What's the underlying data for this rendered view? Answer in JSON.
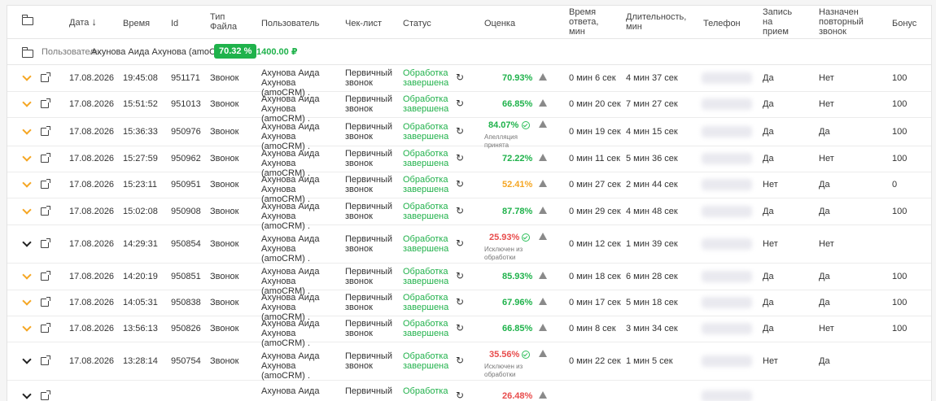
{
  "header": {
    "date": "Дата",
    "time": "Время",
    "id": "Id",
    "file_type": "Тип Файла",
    "user": "Пользователь",
    "checklist": "Чек-лист",
    "status": "Статус",
    "score": "Оценка",
    "response_time": "Время ответа, мин",
    "duration": "Длительность, мин",
    "phone": "Телефон",
    "appointment": "Запись на прием",
    "repeat_call": "Назначен повторный звонок",
    "bonus": "Бонус"
  },
  "group": {
    "label": "Пользователь:",
    "name": "Ахунова Аида Ахунова (amoCRM) .",
    "percent": "70.32 %",
    "amount": "1400.00 ₽"
  },
  "rows": [
    {
      "date": "17.08.2026",
      "time": "19:45:08",
      "id": "951171",
      "type": "Звонок",
      "user": "Ахунова Аида Ахунова (amoCRM) .",
      "checklist": "Первичный звонок",
      "status": "Обработка завершена",
      "score": "70.93%",
      "score_color": "green",
      "note": "",
      "response": "0 мин 6 сек",
      "duration": "4 мин 37 сек",
      "appointment": "Да",
      "repeat": "Нет",
      "bonus": "100",
      "expanded": false
    },
    {
      "date": "17.08.2026",
      "time": "15:51:52",
      "id": "951013",
      "type": "Звонок",
      "user": "Ахунова Аида Ахунова (amoCRM) .",
      "checklist": "Первичный звонок",
      "status": "Обработка завершена",
      "score": "66.85%",
      "score_color": "green",
      "note": "",
      "response": "0 мин 20 сек",
      "duration": "7 мин 27 сек",
      "appointment": "Да",
      "repeat": "Нет",
      "bonus": "100",
      "expanded": false
    },
    {
      "date": "17.08.2026",
      "time": "15:36:33",
      "id": "950976",
      "type": "Звонок",
      "user": "Ахунова Аида Ахунова (amoCRM) .",
      "checklist": "Первичный звонок",
      "status": "Обработка завершена",
      "score": "84.07%",
      "score_color": "green",
      "note": "Апелляция принята",
      "response": "0 мин 19 сек",
      "duration": "4 мин 15 сек",
      "appointment": "Да",
      "repeat": "Да",
      "bonus": "100",
      "expanded": false
    },
    {
      "date": "17.08.2026",
      "time": "15:27:59",
      "id": "950962",
      "type": "Звонок",
      "user": "Ахунова Аида Ахунова (amoCRM) .",
      "checklist": "Первичный звонок",
      "status": "Обработка завершена",
      "score": "72.22%",
      "score_color": "green",
      "note": "",
      "response": "0 мин 11 сек",
      "duration": "5 мин 36 сек",
      "appointment": "Да",
      "repeat": "Нет",
      "bonus": "100",
      "expanded": false
    },
    {
      "date": "17.08.2026",
      "time": "15:23:11",
      "id": "950951",
      "type": "Звонок",
      "user": "Ахунова Аида Ахунова (amoCRM) .",
      "checklist": "Первичный звонок",
      "status": "Обработка завершена",
      "score": "52.41%",
      "score_color": "orange",
      "note": "",
      "response": "0 мин 27 сек",
      "duration": "2 мин 44 сек",
      "appointment": "Нет",
      "repeat": "Да",
      "bonus": "0",
      "expanded": false
    },
    {
      "date": "17.08.2026",
      "time": "15:02:08",
      "id": "950908",
      "type": "Звонок",
      "user": "Ахунова Аида Ахунова (amoCRM) .",
      "checklist": "Первичный звонок",
      "status": "Обработка завершена",
      "score": "87.78%",
      "score_color": "green",
      "note": "",
      "response": "0 мин 29 сек",
      "duration": "4 мин 48 сек",
      "appointment": "Да",
      "repeat": "Да",
      "bonus": "100",
      "expanded": false
    },
    {
      "date": "17.08.2026",
      "time": "14:29:31",
      "id": "950854",
      "type": "Звонок",
      "user": "Ахунова Аида Ахунова (amoCRM) .",
      "checklist": "Первичный звонок",
      "status": "Обработка завершена",
      "score": "25.93%",
      "score_color": "red",
      "note": "Исключен из обработки",
      "response": "0 мин 12 сек",
      "duration": "1 мин 39 сек",
      "appointment": "Нет",
      "repeat": "Нет",
      "bonus": "",
      "expanded": true
    },
    {
      "date": "17.08.2026",
      "time": "14:20:19",
      "id": "950851",
      "type": "Звонок",
      "user": "Ахунова Аида Ахунова (amoCRM) .",
      "checklist": "Первичный звонок",
      "status": "Обработка завершена",
      "score": "85.93%",
      "score_color": "green",
      "note": "",
      "response": "0 мин 18 сек",
      "duration": "6 мин 28 сек",
      "appointment": "Да",
      "repeat": "Да",
      "bonus": "100",
      "expanded": false
    },
    {
      "date": "17.08.2026",
      "time": "14:05:31",
      "id": "950838",
      "type": "Звонок",
      "user": "Ахунова Аида Ахунова (amoCRM) .",
      "checklist": "Первичный звонок",
      "status": "Обработка завершена",
      "score": "67.96%",
      "score_color": "green",
      "note": "",
      "response": "0 мин 17 сек",
      "duration": "5 мин 18 сек",
      "appointment": "Да",
      "repeat": "Да",
      "bonus": "100",
      "expanded": false
    },
    {
      "date": "17.08.2026",
      "time": "13:56:13",
      "id": "950826",
      "type": "Звонок",
      "user": "Ахунова Аида Ахунова (amoCRM) .",
      "checklist": "Первичный звонок",
      "status": "Обработка завершена",
      "score": "66.85%",
      "score_color": "green",
      "note": "",
      "response": "0 мин 8 сек",
      "duration": "3 мин 34 сек",
      "appointment": "Да",
      "repeat": "Нет",
      "bonus": "100",
      "expanded": false
    },
    {
      "date": "17.08.2026",
      "time": "13:28:14",
      "id": "950754",
      "type": "Звонок",
      "user": "Ахунова Аида Ахунова (amoCRM) .",
      "checklist": "Первичный звонок",
      "status": "Обработка завершена",
      "score": "35.56%",
      "score_color": "red",
      "note": "Исключен из обработки",
      "response": "0 мин 22 сек",
      "duration": "1 мин 5 сек",
      "appointment": "Нет",
      "repeat": "Да",
      "bonus": "",
      "expanded": true
    },
    {
      "date": "",
      "time": "",
      "id": "",
      "type": "",
      "user": "Ахунова Аида",
      "checklist": "Первичный",
      "status": "Обработка",
      "score": "26.48%",
      "score_color": "red",
      "note": "",
      "response": "",
      "duration": "",
      "appointment": "",
      "repeat": "",
      "bonus": "",
      "expanded": true
    }
  ]
}
